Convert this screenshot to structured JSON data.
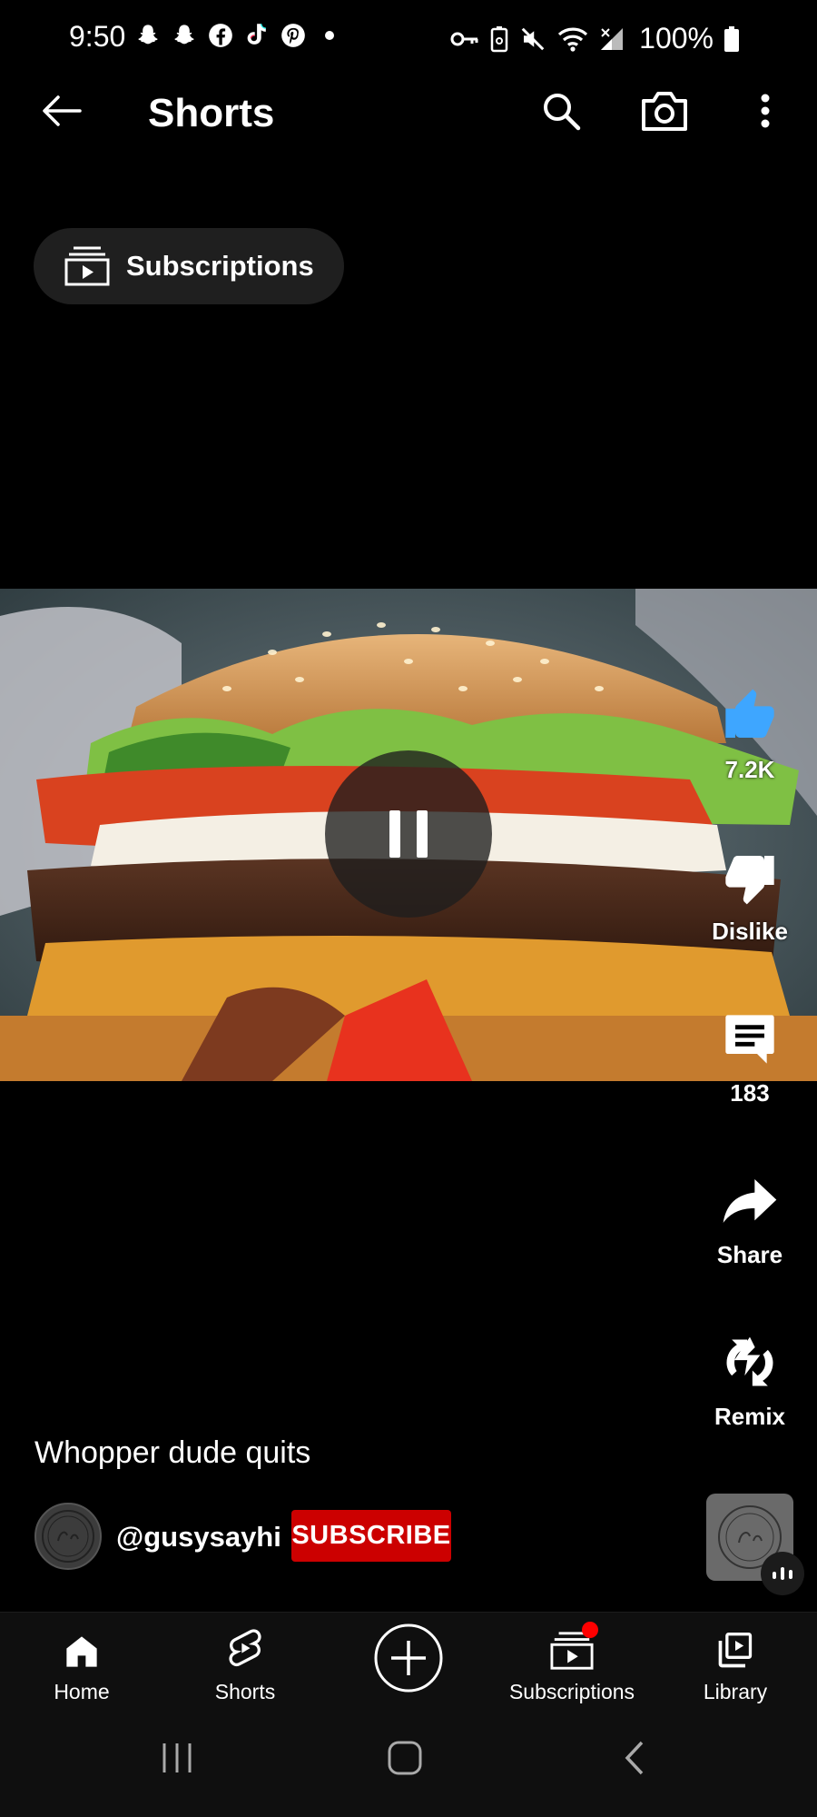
{
  "status_bar": {
    "time": "9:50",
    "battery": "100%",
    "notification_icons": [
      "snapchat-icon",
      "snapchat-icon",
      "facebook-icon",
      "tiktok-icon",
      "pinterest-icon",
      "dot-icon"
    ],
    "system_icons": [
      "key-icon",
      "battery-saver-icon",
      "mute-icon",
      "wifi-icon",
      "signal-icon",
      "battery-icon"
    ]
  },
  "header": {
    "title": "Shorts"
  },
  "chip": {
    "label": "Subscriptions"
  },
  "actions": {
    "like": "7.2K",
    "dislike": "Dislike",
    "comments": "183",
    "share": "Share",
    "remix": "Remix"
  },
  "video": {
    "caption": "Whopper dude quits",
    "channel": "@gusysayhi",
    "subscribe": "SUBSCRIBE"
  },
  "bottom_nav": {
    "home": "Home",
    "shorts": "Shorts",
    "subscriptions": "Subscriptions",
    "library": "Library"
  },
  "colors": {
    "accent_like": "#1e88e5",
    "subscribe": "#cc0000",
    "notification_dot": "#ff0000",
    "background": "#000000"
  }
}
